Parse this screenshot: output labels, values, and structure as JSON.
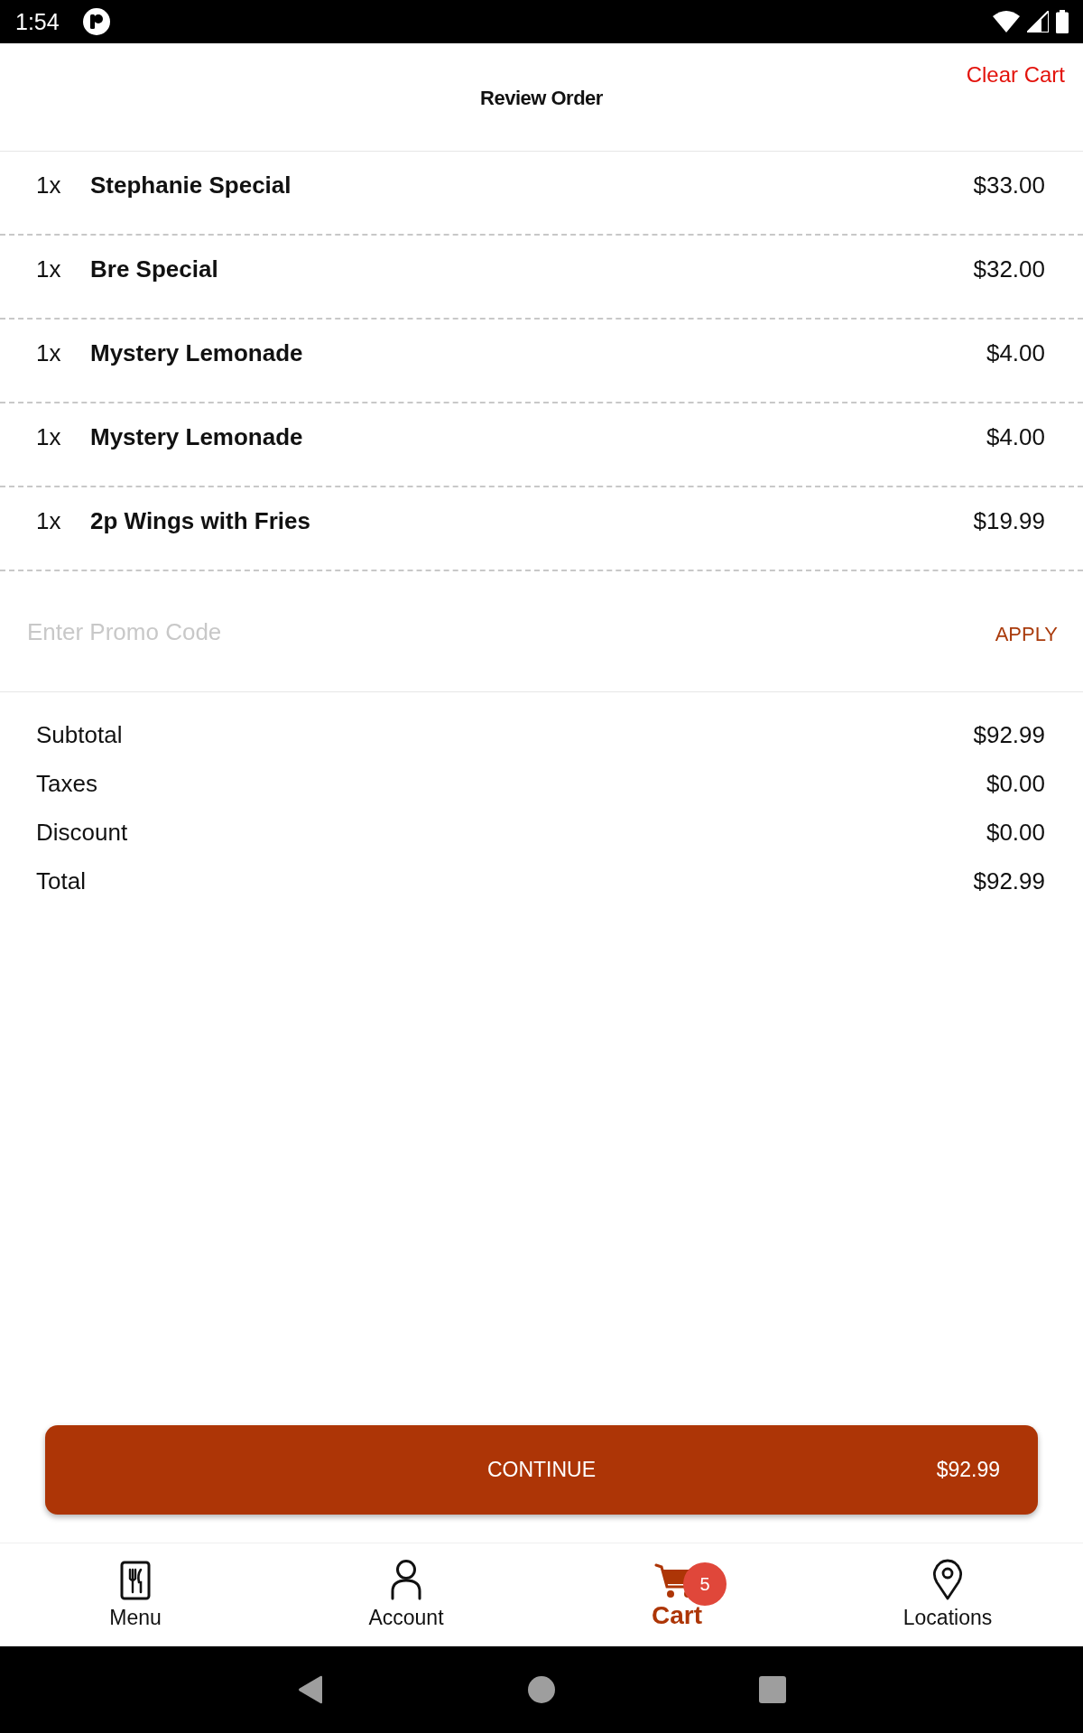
{
  "status_bar": {
    "time": "1:54"
  },
  "header": {
    "title": "Review Order",
    "action": "Clear Cart"
  },
  "items": [
    {
      "quantity": "1x",
      "name": "Stephanie Special",
      "price": "$33.00"
    },
    {
      "quantity": "1x",
      "name": "Bre Special",
      "price": "$32.00"
    },
    {
      "quantity": "1x",
      "name": "Mystery Lemonade",
      "price": "$4.00"
    },
    {
      "quantity": "1x",
      "name": "Mystery Lemonade",
      "price": "$4.00"
    },
    {
      "quantity": "1x",
      "name": "2p Wings with Fries",
      "price": "$19.99"
    }
  ],
  "promo": {
    "placeholder": "Enter Promo Code",
    "button": "APPLY"
  },
  "summary": [
    {
      "label": "Subtotal",
      "value": "$92.99"
    },
    {
      "label": "Taxes",
      "value": "$0.00"
    },
    {
      "label": "Discount",
      "value": "$0.00"
    },
    {
      "label": "Total",
      "value": "$92.99"
    }
  ],
  "continue_button": {
    "label": "CONTINUE",
    "amount": "$92.99"
  },
  "bottom_nav": [
    {
      "kind": "menu",
      "label": "Menu",
      "selected": false
    },
    {
      "kind": "account",
      "label": "Account",
      "selected": false
    },
    {
      "kind": "cart",
      "label": "Cart",
      "selected": true,
      "badge": "5"
    },
    {
      "kind": "locations",
      "label": "Locations",
      "selected": false
    }
  ]
}
